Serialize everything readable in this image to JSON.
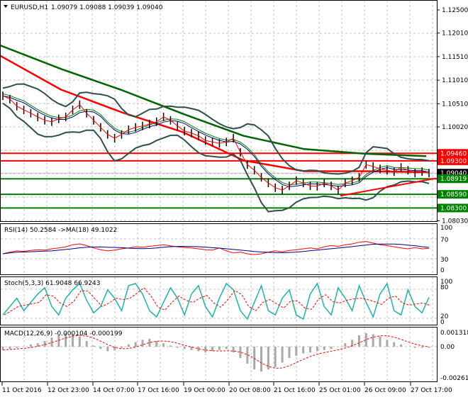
{
  "header": {
    "symbol": "EURUSD,H1",
    "ohlc": "1.09079 1.09088 1.09039 1.09040"
  },
  "indicators": {
    "rsi_label": "RSI(14) 50.2584  ->MA(18) 49.1022",
    "stoch_label": "Stoch(5,3,3) 61.9048 66.9243",
    "macd_label": "MACD(12,26,9) -0.000104 -0.000199"
  },
  "price_axis": [
    "1.12500",
    "1.12010",
    "1.11510",
    "1.11010",
    "1.10510",
    "1.10020",
    "1.08030"
  ],
  "price_axis_values": [
    1.125,
    1.1201,
    1.1151,
    1.1101,
    1.1051,
    1.1002,
    1.0803
  ],
  "rsi_axis": [
    "100",
    "70",
    "30",
    "0"
  ],
  "stoch_axis": [
    "100",
    "80",
    "20",
    "0"
  ],
  "macd_axis": [
    "0.001318",
    "0.00",
    "-0.002615"
  ],
  "time_axis": [
    "11 Oct 2016",
    "12 Oct 23:00",
    "14 Oct 07:00",
    "17 Oct 16:00",
    "19 Oct 00:00",
    "20 Oct 08:00",
    "21 Oct 16:00",
    "25 Oct 01:00",
    "26 Oct 09:00",
    "27 Oct 17:00"
  ],
  "levels": [
    {
      "label": "1.09460",
      "value": 1.0946,
      "color": "#ff0000"
    },
    {
      "label": "1.09300",
      "value": 1.093,
      "color": "#ff0000"
    },
    {
      "label": "1.09040",
      "value": 1.0904,
      "color": "#000000"
    },
    {
      "label": "1.08919",
      "value": 1.08919,
      "color": "#008000"
    },
    {
      "label": "1.08590",
      "value": 1.0859,
      "color": "#008000"
    },
    {
      "label": "1.08300",
      "value": 1.083,
      "color": "#008000"
    }
  ],
  "chart_data": {
    "type": "line",
    "title": "EURUSD,H1",
    "ylim": [
      1.079,
      1.127
    ],
    "close": [
      1.1068,
      1.1061,
      1.1046,
      1.1038,
      1.1031,
      1.1023,
      1.1016,
      1.1013,
      1.1019,
      1.1023,
      1.1038,
      1.1049,
      1.1031,
      1.1016,
      1.1001,
      1.0986,
      1.0978,
      1.0986,
      1.0996,
      1.1001,
      1.1004,
      1.1008,
      1.1013,
      1.1023,
      1.1016,
      1.1004,
      1.0993,
      1.0989,
      1.0983,
      1.0973,
      1.097,
      1.0967,
      1.097,
      1.0978,
      1.0948,
      1.0922,
      1.091,
      1.0895,
      1.0883,
      1.0873,
      1.0868,
      1.0877,
      1.0888,
      1.0883,
      1.0877,
      1.0876,
      1.0883,
      1.0877,
      1.0868,
      1.0883,
      1.0888,
      1.0895,
      1.0922,
      1.0918,
      1.0913,
      1.091,
      1.0907,
      1.0916,
      1.091,
      1.0904,
      1.0907,
      1.0904
    ],
    "ma_slow": [
      1.1175,
      1.1125,
      1.108,
      1.103,
      1.0983,
      1.0955,
      1.0945,
      1.094
    ],
    "ma_mid": [
      1.1153,
      1.1081,
      1.1033,
      1.0991,
      1.0931,
      1.0908,
      1.0908,
      1.0906
    ],
    "trendline": [
      1.0856,
      1.0893
    ],
    "rsi": [
      38,
      42,
      45,
      44,
      46,
      48,
      47,
      50,
      52,
      55,
      60,
      62,
      58,
      52,
      48,
      45,
      47,
      50,
      52,
      55,
      54,
      56,
      58,
      60,
      57,
      55,
      53,
      52,
      50,
      48,
      47,
      52,
      45,
      40,
      42,
      38,
      36,
      38,
      42,
      45,
      43,
      46,
      48,
      50,
      52,
      50,
      55,
      58,
      56,
      60,
      62,
      66,
      68,
      64,
      60,
      58,
      55,
      52,
      50,
      53,
      50,
      51
    ],
    "stoch": [
      20,
      40,
      60,
      30,
      50,
      70,
      85,
      40,
      20,
      60,
      80,
      95,
      55,
      25,
      40,
      80,
      60,
      30,
      90,
      95,
      70,
      30,
      15,
      50,
      85,
      60,
      20,
      70,
      90,
      40,
      15,
      60,
      95,
      80,
      30,
      10,
      50,
      90,
      30,
      20,
      60,
      80,
      20,
      10,
      70,
      95,
      40,
      20,
      85,
      60,
      30,
      90,
      50,
      15,
      70,
      95,
      30,
      20,
      80,
      40,
      25,
      62
    ],
    "macd": [
      -0.0003,
      -0.0002,
      -0.0001,
      0,
      0.0002,
      0.0003,
      0.0005,
      0.0008,
      0.001,
      0.0012,
      0.0011,
      0.0009,
      0.0005,
      0.0001,
      -0.0002,
      -0.0004,
      -0.0003,
      -0.0001,
      0.0002,
      0.0004,
      0.0006,
      0.0007,
      0.0005,
      0.0003,
      0.0001,
      -0.0001,
      -0.0002,
      -0.0003,
      -0.0004,
      -0.0005,
      -0.0004,
      -0.0003,
      -0.0002,
      -0.0005,
      -0.001,
      -0.0015,
      -0.002,
      -0.0022,
      -0.002,
      -0.0018,
      -0.0014,
      -0.001,
      -0.0008,
      -0.0006,
      -0.0005,
      -0.0004,
      -0.0003,
      -0.0002,
      0,
      0.0003,
      0.0006,
      0.001,
      0.0012,
      0.0011,
      0.0009,
      0.0006,
      0.0004,
      0.0002,
      0,
      -0.0001,
      -0.0001,
      -0.0001
    ]
  }
}
